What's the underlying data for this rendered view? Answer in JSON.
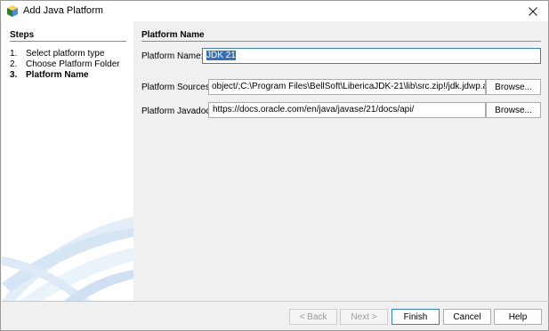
{
  "window": {
    "title": "Add Java Platform",
    "icon": "netbeans-cube-icon",
    "close_icon": "close-icon"
  },
  "steps": {
    "title": "Steps",
    "items": [
      {
        "num": "1.",
        "label": "Select platform type",
        "current": false
      },
      {
        "num": "2.",
        "label": "Choose Platform Folder",
        "current": false
      },
      {
        "num": "3.",
        "label": "Platform Name",
        "current": true
      }
    ]
  },
  "main": {
    "section_title": "Platform Name",
    "platform_name": {
      "label": "Platform Name:",
      "value": "JDK 21"
    },
    "platform_sources": {
      "label": "Platform Sources:",
      "value": "object/;C:\\Program Files\\BellSoft\\LibericaJDK-21\\lib\\src.zip!/jdk.jdwp.agent/",
      "browse_label": "Browse..."
    },
    "platform_javadoc": {
      "label": "Platform Javadoc:",
      "value": "https://docs.oracle.com/en/java/javase/21/docs/api/",
      "browse_label": "Browse..."
    }
  },
  "buttons": {
    "back": "< Back",
    "next": "Next >",
    "finish": "Finish",
    "cancel": "Cancel",
    "help": "Help"
  },
  "colors": {
    "selection": "#3a6fb0",
    "panel_bg": "#f0f0f0",
    "steps_bg": "#ffffff"
  }
}
